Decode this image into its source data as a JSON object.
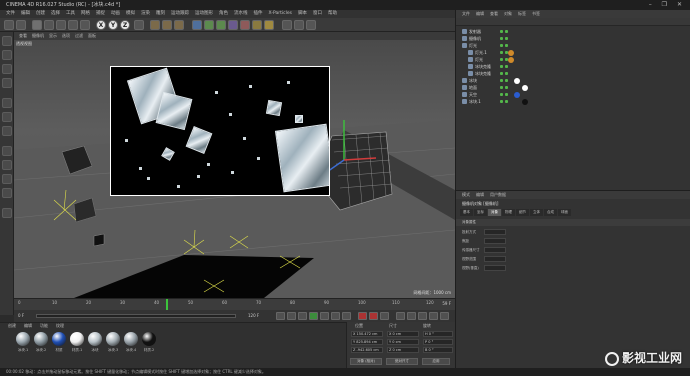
{
  "window": {
    "title": "CINEMA 4D R16.027 Studio (RC) - [冰块.c4d *]",
    "controls": "–  ❐  ✕"
  },
  "menubar": {
    "items": [
      "文件",
      "编辑",
      "创建",
      "选择",
      "工具",
      "网格",
      "捕捉",
      "动画",
      "模拟",
      "渲染",
      "雕刻",
      "运动跟踪",
      "运动图形",
      "角色",
      "流水线",
      "插件",
      "X-Particles",
      "脚本",
      "窗口",
      "帮助"
    ]
  },
  "toolbar": {
    "axes": [
      "X",
      "Y",
      "Z"
    ]
  },
  "viewport": {
    "menu": [
      "查看",
      "摄像机",
      "显示",
      "选项",
      "过滤",
      "面板"
    ],
    "label": "透视视图",
    "grid_info": "网格间距：1000 cm"
  },
  "timeline": {
    "ticks": [
      "0",
      "10",
      "20",
      "30",
      "40",
      "50",
      "60",
      "70",
      "80",
      "90",
      "100",
      "110",
      "120"
    ],
    "current_frame": "0 F",
    "end_frame": "120 F",
    "frame_display": "59 F"
  },
  "materials": {
    "menu": [
      "创建",
      "编辑",
      "功能",
      "纹理"
    ],
    "items": [
      {
        "label": "冰块.1",
        "color": "#9aa6ae"
      },
      {
        "label": "冰块.2",
        "color": "#8f9ca4"
      },
      {
        "label": "材质",
        "color": "#1f4fb5"
      },
      {
        "label": "材质.1",
        "color": "#f0f0f0"
      },
      {
        "label": "冰块",
        "color": "#b7c1c7"
      },
      {
        "label": "冰块.3",
        "color": "#a3adb3"
      },
      {
        "label": "冰块.4",
        "color": "#98a2a9"
      },
      {
        "label": "材质.2",
        "color": "#111111"
      }
    ]
  },
  "coordinates": {
    "headers": [
      "位置",
      "尺寸",
      "旋转"
    ],
    "position": [
      "X  150.472 cm",
      "Y  825.894 cm",
      "Z  -942.605 cm"
    ],
    "size": [
      "X  0 cm",
      "Y  0 cm",
      "Z  0 cm"
    ],
    "rotation": [
      "H  0 °",
      "P  0 °",
      "B  0 °"
    ],
    "mode_button": "对象 (相对)",
    "size_button": "绝对尺寸",
    "apply_button": "应用"
  },
  "object_manager": {
    "menu": [
      "文件",
      "编辑",
      "查看",
      "对象",
      "标签",
      "书签"
    ],
    "objects": [
      {
        "name": "发射器",
        "indent": 0
      },
      {
        "name": "摄像机",
        "indent": 0
      },
      {
        "name": "灯光",
        "indent": 0
      },
      {
        "name": "灯光.1",
        "indent": 1
      },
      {
        "name": "灯光",
        "indent": 1
      },
      {
        "name": "冰块克隆",
        "indent": 1
      },
      {
        "name": "冰块克隆",
        "indent": 1
      },
      {
        "name": "冰块",
        "indent": 0
      },
      {
        "name": "地面",
        "indent": 0
      },
      {
        "name": "天空",
        "indent": 0
      },
      {
        "name": "冰块.1",
        "indent": 0
      }
    ]
  },
  "attribute_manager": {
    "menu": [
      "模式",
      "编辑",
      "用户数据"
    ],
    "title": "摄像机对象 [摄像机]",
    "tabs": [
      "基本",
      "坐标",
      "对象",
      "物理",
      "细节",
      "立体",
      "合成",
      "球面"
    ],
    "section": "对象属性",
    "fields": [
      "投射方式",
      "焦距",
      "传感器尺寸",
      "视野范围",
      "视野(垂直)"
    ]
  },
  "statusbar": {
    "text": "00:00:02  移动：点击并拖动鼠标移动元素。按住 SHIFT 键量化移动；节点编辑模式时按住 SHIFT 键增加选择对象；按住 CTRL 键减少选择对象。"
  },
  "watermark": {
    "text": "影视工业网"
  }
}
